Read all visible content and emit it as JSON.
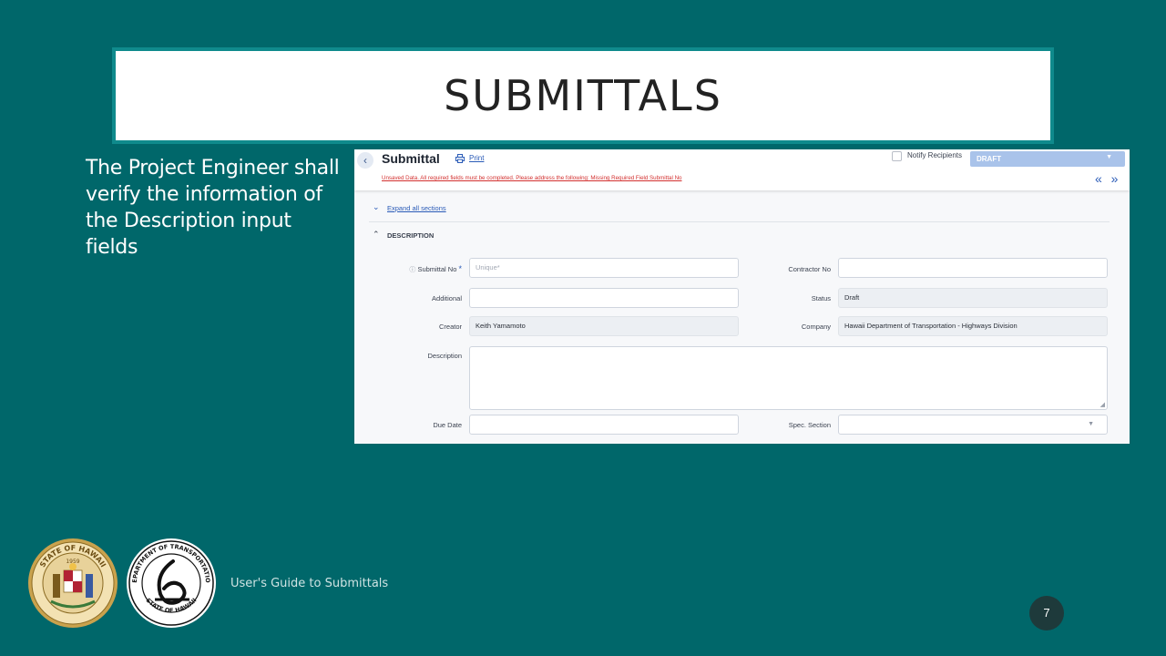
{
  "slide": {
    "title": "SUBMITTALS",
    "lead_text": "The Project Engineer shall verify the information of the Description input fields",
    "footer_text": "User's Guide to Submittals",
    "page_number": "7"
  },
  "app": {
    "back_icon": "chevron-left-icon",
    "title": "Submittal",
    "print_label": "Print",
    "notify_label": "Notify Recipients",
    "notify_checked": false,
    "status_select": "DRAFT",
    "warning": "Unsaved Data. All required fields must be completed. Please address the following: Missing Required Field Submittal No",
    "nav_arrows": "« »",
    "expand_all": "Expand all sections",
    "section_title": "DESCRIPTION"
  },
  "fields": {
    "submittal_no": {
      "label": "Submittal No",
      "value": "",
      "placeholder": "Unique*"
    },
    "contractor_no": {
      "label": "Contractor No",
      "value": ""
    },
    "additional": {
      "label": "Additional",
      "value": ""
    },
    "status": {
      "label": "Status",
      "value": "Draft"
    },
    "creator": {
      "label": "Creator",
      "value": "Keith Yamamoto"
    },
    "company": {
      "label": "Company",
      "value": "Hawaii Department of Transportation - Highways Division"
    },
    "description": {
      "label": "Description",
      "value": ""
    },
    "due_date": {
      "label": "Due Date",
      "value": ""
    },
    "spec_section": {
      "label": "Spec. Section",
      "value": ""
    }
  },
  "colors": {
    "background": "#00676a",
    "title_border": "#0f8a8c",
    "link": "#2a5bb7",
    "warning": "#d3302f",
    "status_select": "#a9c3ea"
  },
  "logos": {
    "seal_text": "STATE OF HAWAII 1959",
    "dot_text": "DEPARTMENT OF TRANSPORTATION STATE OF HAWAII"
  }
}
